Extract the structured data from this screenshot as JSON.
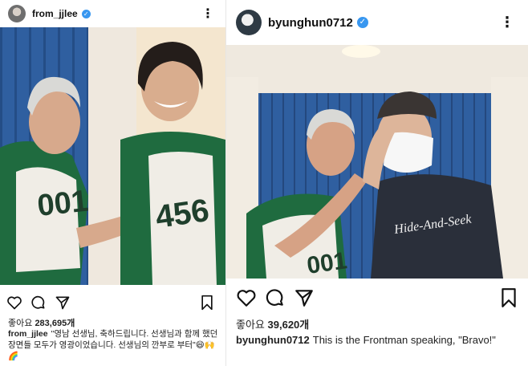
{
  "left_post": {
    "username": "from_jjlee",
    "verified_mark": "✓",
    "more_glyph": "⋮",
    "likes_label": "좋아요",
    "likes_count": "283,695개",
    "caption_text": "\"영남 선생님, 축하드립니다. 선생님과 함께 했던 장면들 모두가 영광이었습니다. 선생님의 깐부로 부터\"😄🙌🌈",
    "icons": [
      "heart-icon",
      "comment-icon",
      "share-icon",
      "bookmark-icon"
    ],
    "jersey_numbers": [
      "001",
      "456"
    ]
  },
  "right_post": {
    "username": "byunghun0712",
    "verified_mark": "✓",
    "more_glyph": "⋮",
    "likes_label": "좋아요",
    "likes_count": "39,620개",
    "caption_text": "This is the Frontman speaking, \"Bravo!\"",
    "shirt_text": "Hide-And-Seek",
    "jersey_number": "001",
    "icons": [
      "heart-icon",
      "comment-icon",
      "share-icon",
      "bookmark-icon"
    ]
  },
  "colors": {
    "verified_blue": "#3897f0",
    "track_green": "#1f6b3f",
    "wall_blue": "#2f5fa0"
  }
}
